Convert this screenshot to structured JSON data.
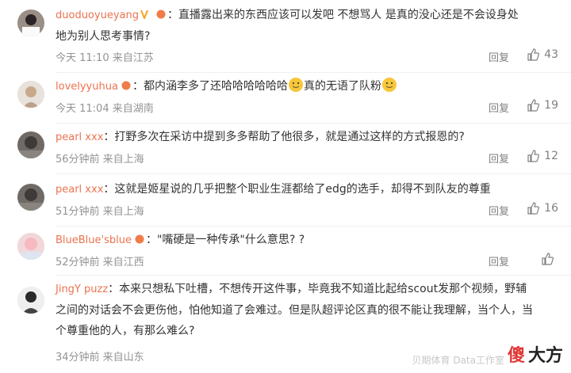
{
  "comments": [
    {
      "username": "duoduoyueyang",
      "text_line1": "：直播露出来的东西应该可以发吧 不想骂人 是真的没心还是不会设身处",
      "text_line2": "地为别人思考事情?",
      "time": "今天 11:10 来自江苏",
      "reply_label": "回复",
      "likes": "43"
    },
    {
      "username": "lovelyyuhua",
      "text_before_emoji": "：都内涵李多了还哈哈哈哈哈哈",
      "text_after_emoji": "真的无语了队粉",
      "time": "今天 11:04 来自湖南",
      "reply_label": "回复",
      "likes": "19"
    },
    {
      "username": "pearl xxx",
      "text_line1": "：打野多次在采访中提到多多帮助了他很多，就是通过这样的方式报恩的?",
      "time": "56分钟前 来自上海",
      "reply_label": "回复",
      "likes": "12"
    },
    {
      "username": "pearl xxx",
      "text_line1": "：这就是姬星说的几乎把整个职业生涯都给了edg的选手，却得不到队友的尊重",
      "time": "51分钟前 来自上海",
      "reply_label": "回复",
      "likes": "16"
    },
    {
      "username": "BlueBlue'sblue",
      "text_line1": "：\"嘴硬是一种传承\"什么意思? ?",
      "time": "52分钟前 来自江西",
      "reply_label": "回复",
      "likes": ""
    },
    {
      "username": "JingY puzz",
      "text_line1": "：本来只想私下吐槽，不想传开这件事，毕竟我不知道比起给scout发那个视频，野辅",
      "text_line2": "之间的对话会不会更伤他，怕他知道了会难过。但是队超评论区真的很不能让我理解，当个人，当",
      "text_line3": "个尊重他的人，有那么难么?",
      "time": "34分钟前 来自山东",
      "reply_label": "",
      "likes": ""
    }
  ],
  "watermark": {
    "small": "贝期体育 Data工作室",
    "big1": "傻",
    "big2": "大方"
  },
  "colors": {
    "username": "#eb7350",
    "meta": "#939393",
    "accent": "#e03636"
  }
}
